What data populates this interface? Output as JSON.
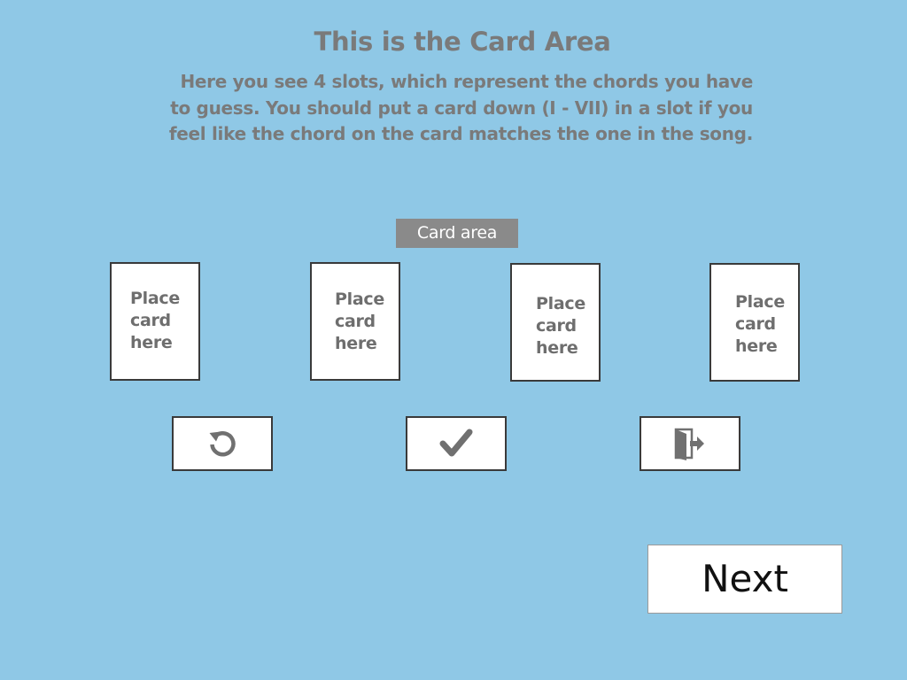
{
  "header": {
    "title": "This is the Card Area",
    "description": "Here you see 4 slots, which represent the chords you have to guess. You should put a card down (I - VII) in a slot if you feel like the chord on the card matches the one in the song."
  },
  "card_area": {
    "label": "Card area",
    "slots": [
      {
        "text": "Place\ncard\nhere"
      },
      {
        "text": "Place\ncard\nhere"
      },
      {
        "text": "Place\ncard\nhere"
      },
      {
        "text": "Place\ncard\nhere"
      }
    ]
  },
  "controls": {
    "reset_icon": "reset-icon",
    "confirm_icon": "checkmark-icon",
    "exit_icon": "exit-door-icon"
  },
  "footer": {
    "next_label": "Next"
  },
  "colors": {
    "background": "#8fc8e6",
    "text_gray": "#7a7a7a",
    "label_bg": "#8a8a8a",
    "border": "#3a3a3a"
  }
}
